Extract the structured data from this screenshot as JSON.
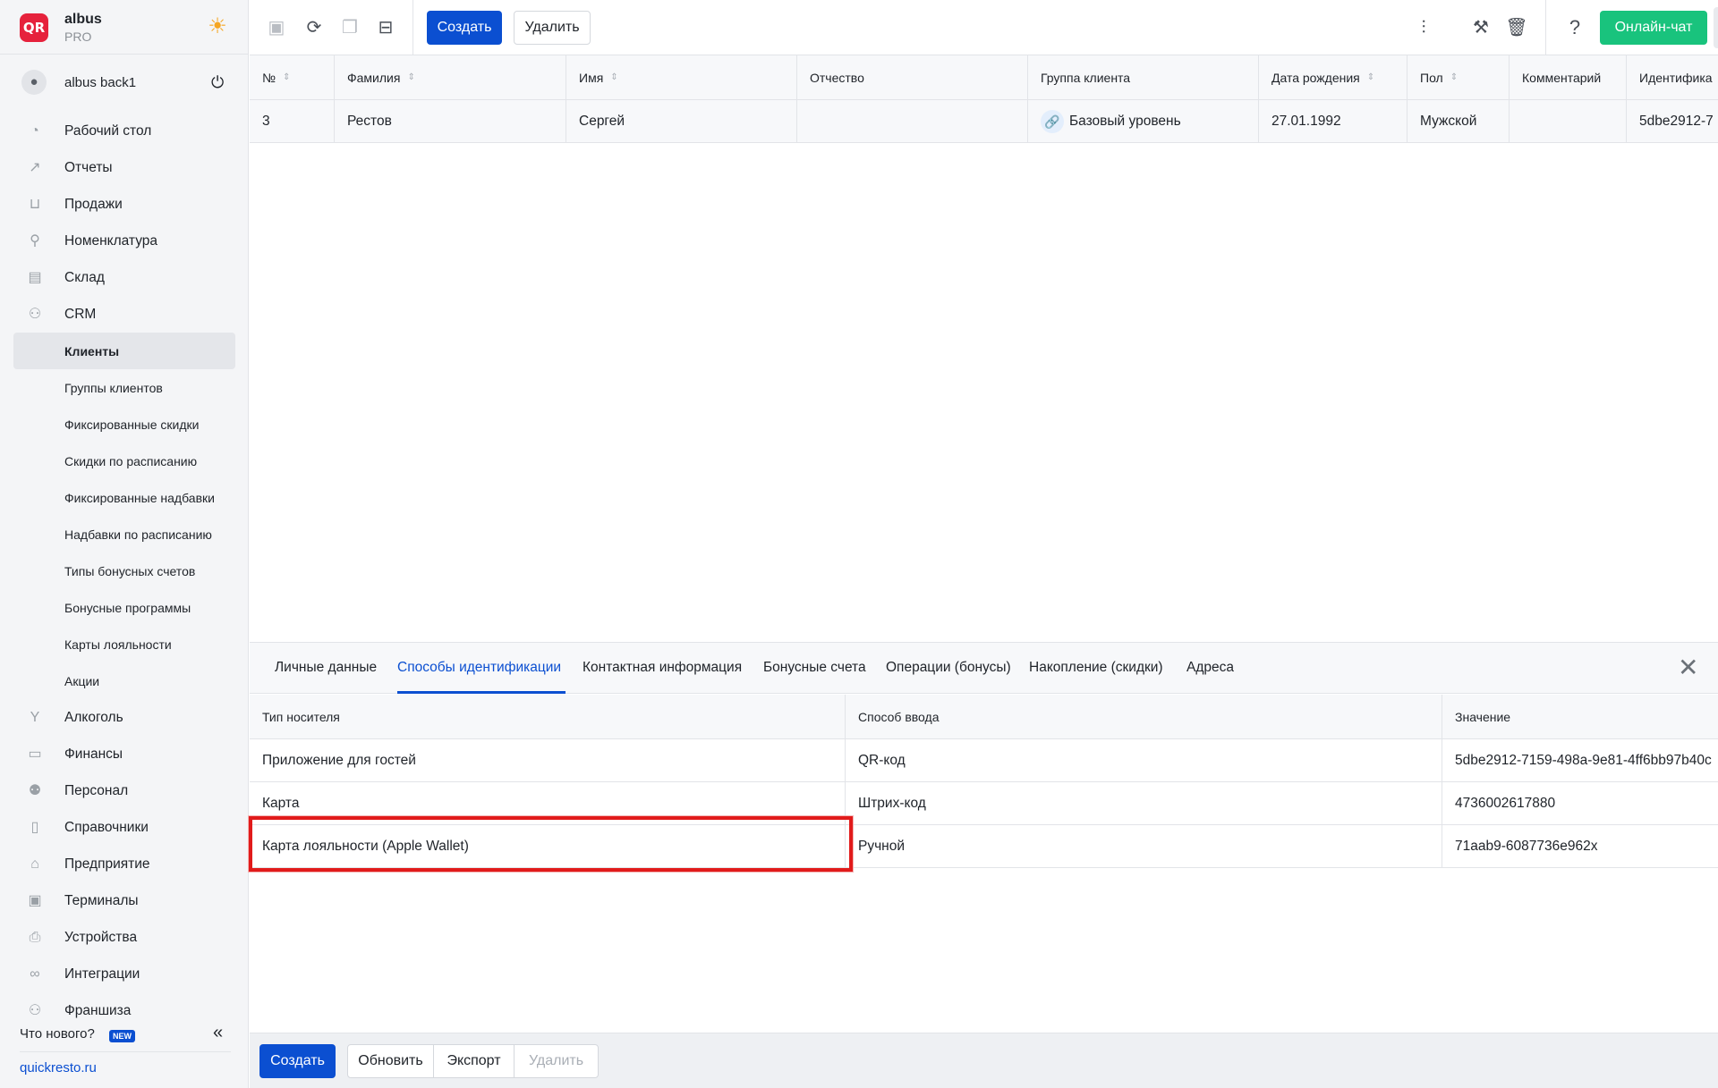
{
  "brand": {
    "name": "albus",
    "plan": "PRO",
    "logo_text": "QR"
  },
  "user": {
    "name": "albus back1"
  },
  "nav": [
    {
      "label": "Рабочий стол",
      "icon": "dashboard-icon",
      "glyph": "◔"
    },
    {
      "label": "Отчеты",
      "icon": "chart-icon",
      "glyph": "↗"
    },
    {
      "label": "Продажи",
      "icon": "basket-icon",
      "glyph": "⊔"
    },
    {
      "label": "Номенклатура",
      "icon": "link-icon",
      "glyph": "⚲"
    },
    {
      "label": "Склад",
      "icon": "warehouse-icon",
      "glyph": "▤"
    },
    {
      "label": "CRM",
      "icon": "crm-icon",
      "glyph": "⚇"
    }
  ],
  "crm_sub": [
    {
      "label": "Клиенты",
      "active": true
    },
    {
      "label": "Группы клиентов"
    },
    {
      "label": "Фиксированные скидки"
    },
    {
      "label": "Скидки по расписанию"
    },
    {
      "label": "Фиксированные надбавки"
    },
    {
      "label": "Надбавки по расписанию"
    },
    {
      "label": "Типы бонусных счетов"
    },
    {
      "label": "Бонусные программы"
    },
    {
      "label": "Карты лояльности"
    },
    {
      "label": "Акции"
    }
  ],
  "nav2": [
    {
      "label": "Алкоголь",
      "icon": "glass-icon",
      "glyph": "Y"
    },
    {
      "label": "Финансы",
      "icon": "wallet-icon",
      "glyph": "▭"
    },
    {
      "label": "Персонал",
      "icon": "people-icon",
      "glyph": "⚉"
    },
    {
      "label": "Справочники",
      "icon": "book-icon",
      "glyph": "▯"
    },
    {
      "label": "Предприятие",
      "icon": "store-icon",
      "glyph": "⌂"
    },
    {
      "label": "Терминалы",
      "icon": "terminal-icon",
      "glyph": "▣"
    },
    {
      "label": "Устройства",
      "icon": "printer-icon",
      "glyph": "⎙"
    },
    {
      "label": "Интеграции",
      "icon": "infinity-icon",
      "glyph": "∞"
    },
    {
      "label": "Франшиза",
      "icon": "franchise-icon",
      "glyph": "⚇"
    }
  ],
  "footer": {
    "whats_new": "Что нового?",
    "new_badge": "NEW",
    "site": "quickresto.ru"
  },
  "toolbar": {
    "create": "Создать",
    "delete": "Удалить",
    "chat": "Онлайн-чат"
  },
  "grid": {
    "columns": [
      "№",
      "Фамилия",
      "Имя",
      "Отчество",
      "Группа клиента",
      "Дата рождения",
      "Пол",
      "Комментарий",
      "Идентифика"
    ],
    "rows": [
      {
        "num": "3",
        "last": "Рестов",
        "first": "Сергей",
        "middle": "",
        "group": "Базовый уровень",
        "birth": "27.01.1992",
        "sex": "Мужской",
        "comment": "",
        "id": "5dbe2912-7"
      }
    ]
  },
  "tabs": [
    "Личные данные",
    "Способы идентификации",
    "Контактная информация",
    "Бонусные счета",
    "Операции (бонусы)",
    "Накопление (скидки)",
    "Адреса"
  ],
  "ident": {
    "columns": [
      "Тип носителя",
      "Способ ввода",
      "Значение"
    ],
    "rows": [
      {
        "type": "Приложение для гостей",
        "method": "QR-код",
        "value": "5dbe2912-7159-498a-9e81-4ff6bb97b40c"
      },
      {
        "type": "Карта",
        "method": "Штрих-код",
        "value": "4736002617880"
      },
      {
        "type": "Карта лояльности (Apple Wallet)",
        "method": "Ручной",
        "value": "71aab9-6087736e962x"
      }
    ]
  },
  "bottom": {
    "create": "Создать",
    "refresh": "Обновить",
    "export": "Экспорт",
    "delete": "Удалить"
  },
  "colors": {
    "accent": "#0b4fd1",
    "chat": "#19c37d",
    "highlight": "#e11b1b"
  }
}
